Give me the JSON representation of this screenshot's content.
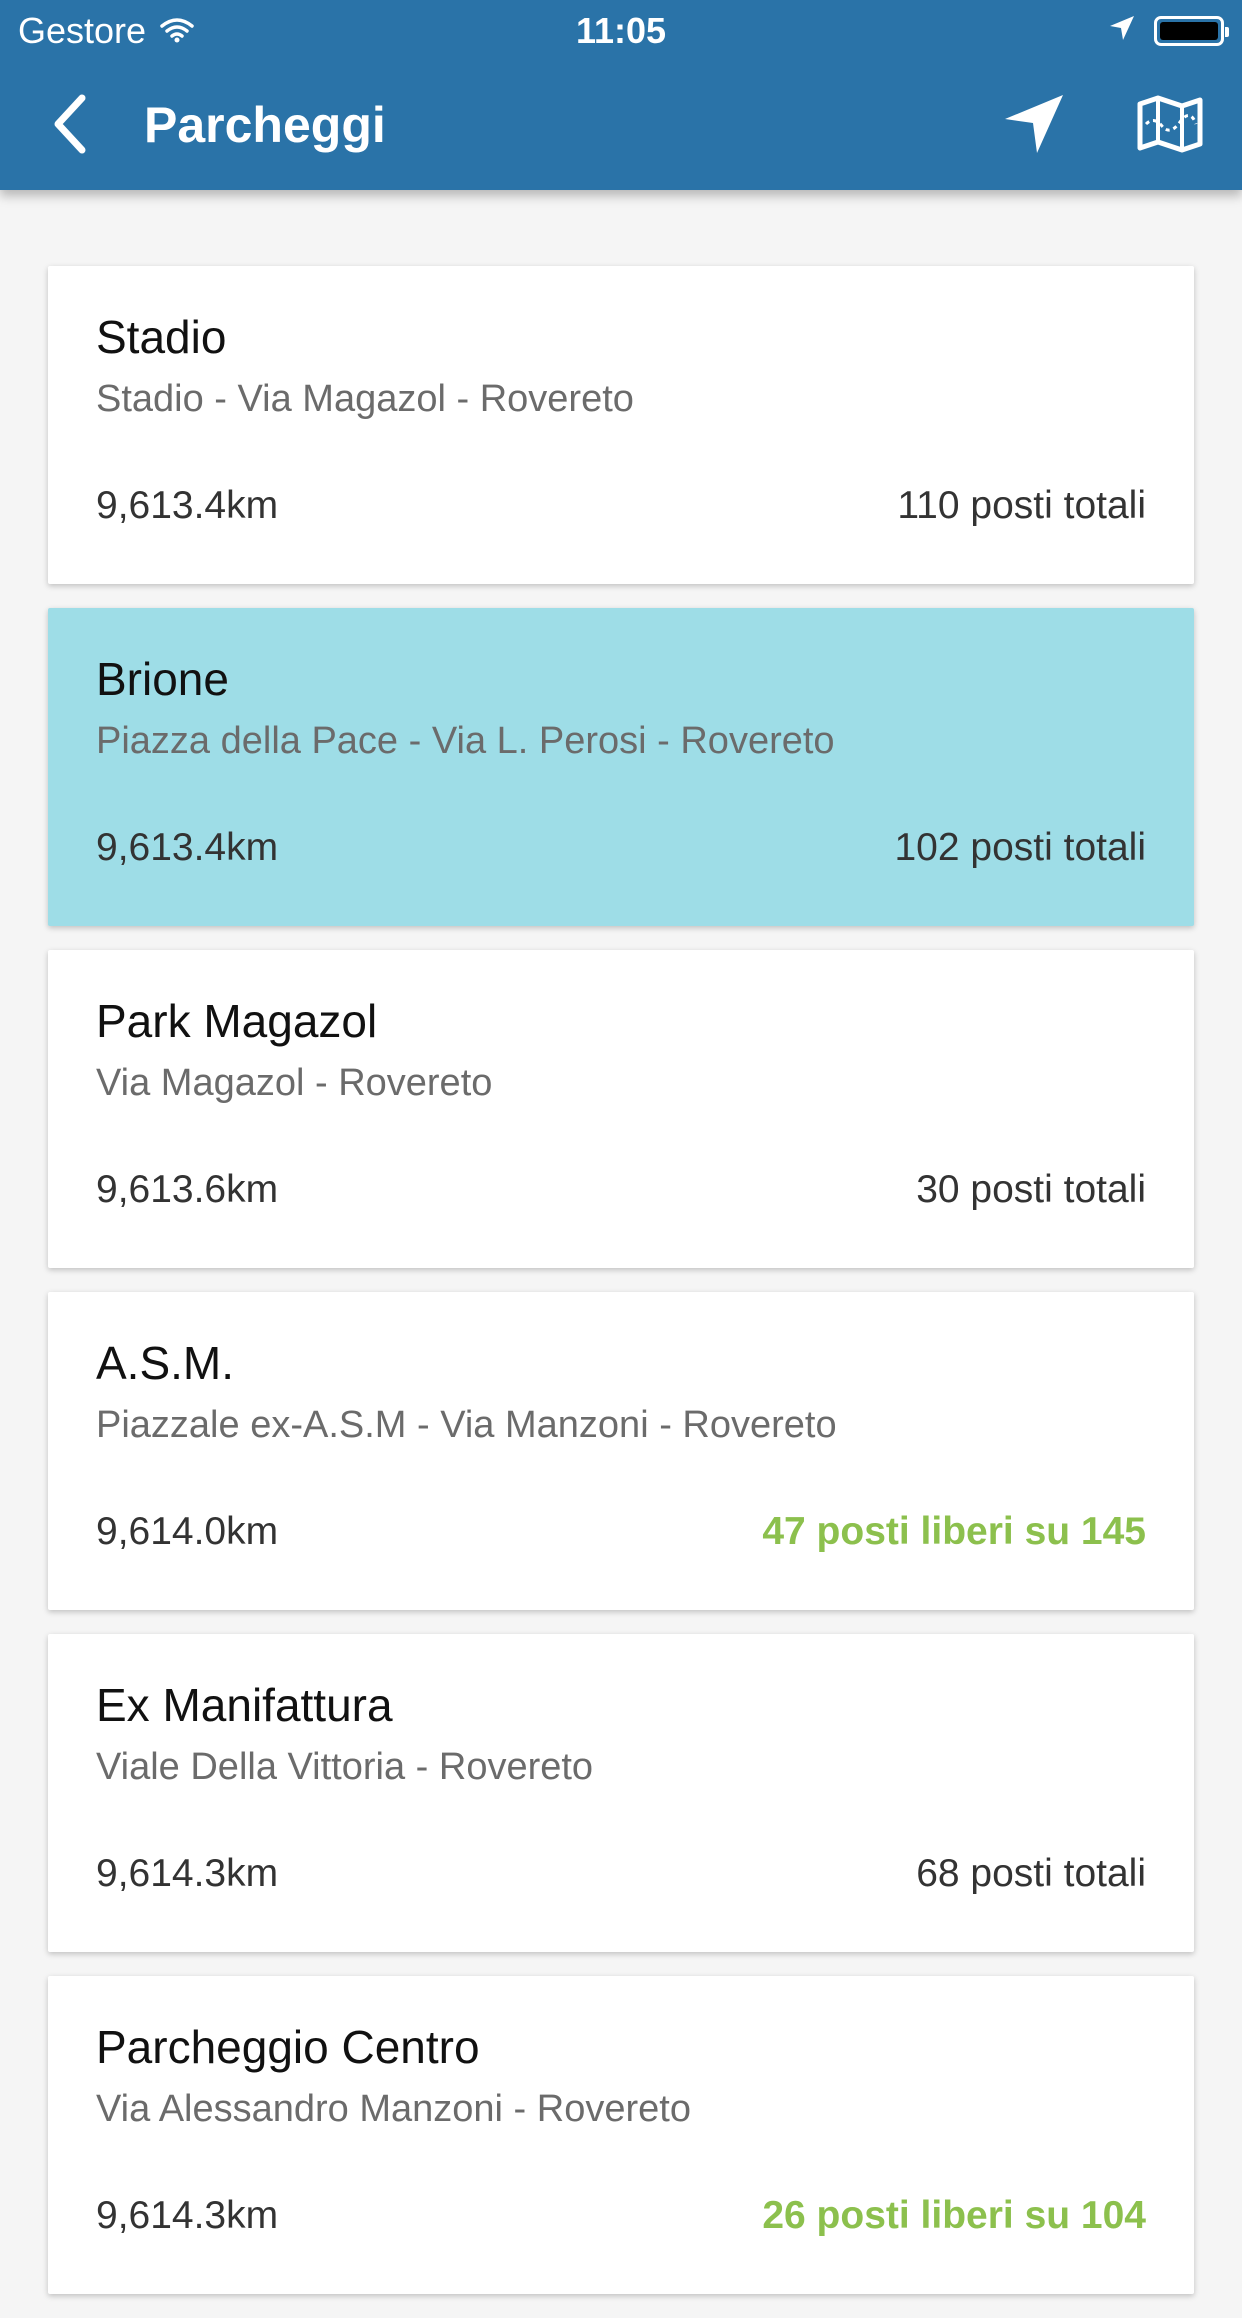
{
  "status_bar": {
    "carrier": "Gestore",
    "time": "11:05"
  },
  "header": {
    "title": "Parcheggi",
    "icons": [
      "back-arrow-icon",
      "location-arrow-icon",
      "map-icon"
    ]
  },
  "colors": {
    "header_bg": "#2a73a8",
    "selected_card_bg": "#9edde7",
    "free_spots_green": "#8cc04d"
  },
  "parkings": [
    {
      "name": "Stadio",
      "address": "Stadio - Via Magazol - Rovereto",
      "distance": "9,613.4km",
      "spots": "110 posti totali",
      "free": false,
      "selected": false
    },
    {
      "name": "Brione",
      "address": "Piazza della Pace - Via L. Perosi - Rovereto",
      "distance": "9,613.4km",
      "spots": "102 posti totali",
      "free": false,
      "selected": true
    },
    {
      "name": "Park Magazol",
      "address": "Via Magazol - Rovereto",
      "distance": "9,613.6km",
      "spots": "30 posti totali",
      "free": false,
      "selected": false
    },
    {
      "name": "A.S.M.",
      "address": "Piazzale ex-A.S.M - Via Manzoni - Rovereto",
      "distance": "9,614.0km",
      "spots": "47 posti liberi su 145",
      "free": true,
      "selected": false
    },
    {
      "name": "Ex Manifattura",
      "address": "Viale Della Vittoria - Rovereto",
      "distance": "9,614.3km",
      "spots": "68 posti totali",
      "free": false,
      "selected": false
    },
    {
      "name": "Parcheggio Centro",
      "address": "Via Alessandro Manzoni - Rovereto",
      "distance": "9,614.3km",
      "spots": "26 posti liberi su 104",
      "free": true,
      "selected": false
    }
  ]
}
